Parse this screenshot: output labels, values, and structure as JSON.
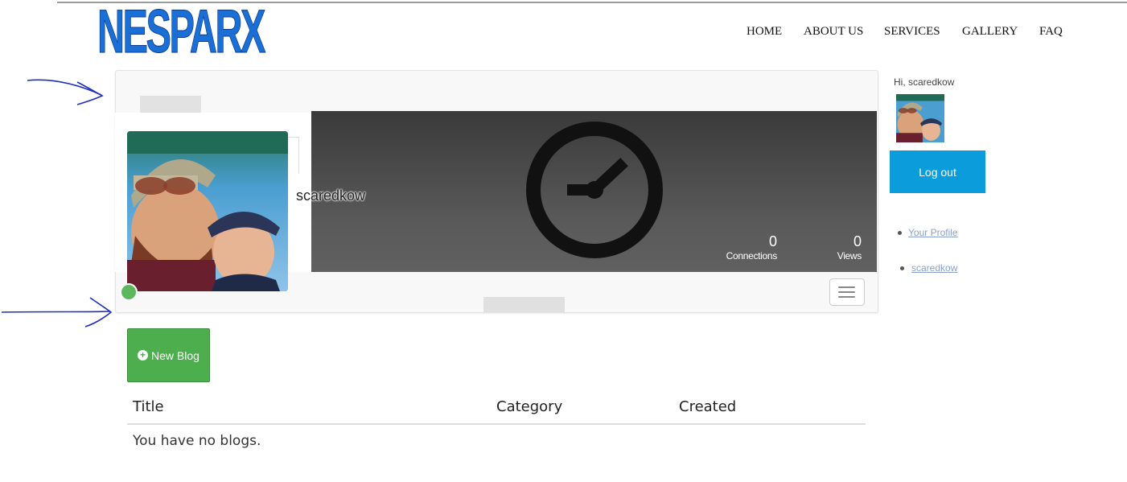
{
  "site": {
    "logo": "NESPARX"
  },
  "nav": {
    "items": [
      "HOME",
      "ABOUT US",
      "SERVICES",
      "GALLERY",
      "FAQ"
    ]
  },
  "profile": {
    "username": "scaredkow",
    "stats": [
      {
        "value": "0",
        "label": "Connections"
      },
      {
        "value": "0",
        "label": "Views"
      }
    ],
    "status": "online"
  },
  "blogs": {
    "new_button": "New Blog",
    "columns": [
      "Title",
      "Category",
      "Created"
    ],
    "empty_message": "You have no blogs."
  },
  "sidebar": {
    "greeting": "Hi, scaredkow",
    "logout": "Log out",
    "links": [
      "Your Profile",
      "scaredkow"
    ]
  },
  "colors": {
    "logo": "#1a6fd6",
    "new_blog_button": "#4cae4c",
    "logout_button": "#0b9ddb",
    "online": "#5cb85c",
    "annotation_arrow": "#1f2fbf"
  }
}
